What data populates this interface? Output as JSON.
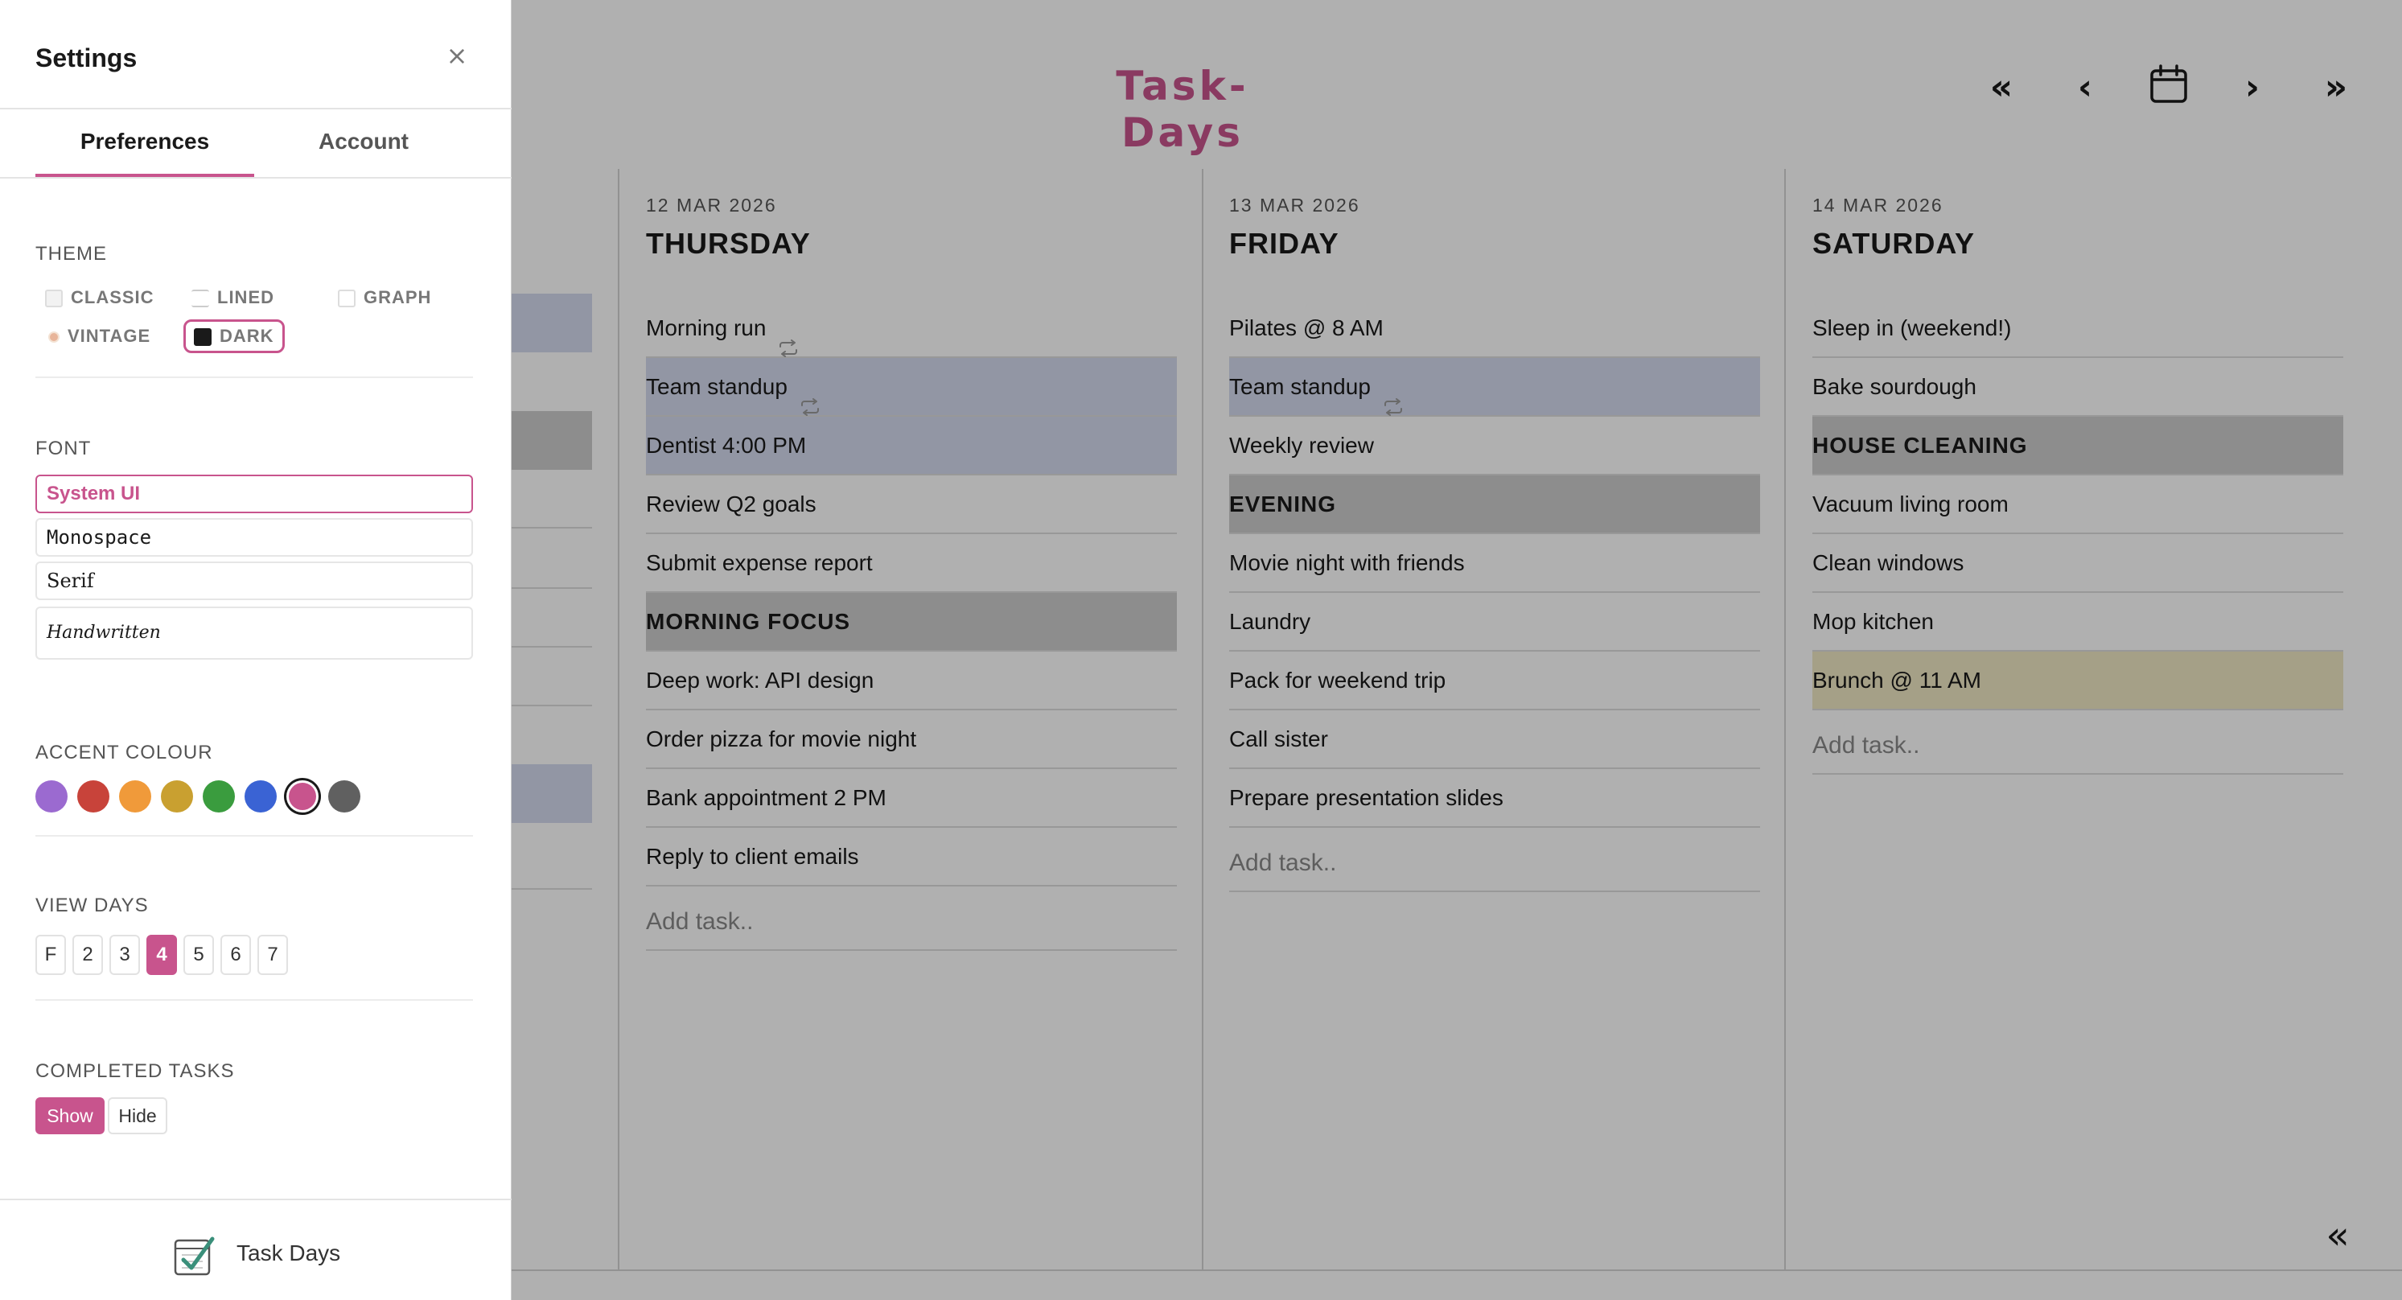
{
  "app": {
    "title": "Task-Days",
    "nav": {
      "first_label": "«",
      "prev_label": "‹",
      "next_label": "›",
      "last_label": "»",
      "collapse_label": "«"
    },
    "accent_color": "#c8548d"
  },
  "days": [
    {
      "date": "12 MAR 2026",
      "name": "THURSDAY",
      "tasks": [
        {
          "text": "Morning run",
          "repeat": true,
          "highlight": "none"
        },
        {
          "text": "Team standup",
          "repeat": true,
          "highlight": "blue"
        },
        {
          "text": "Dentist 4:00 PM",
          "repeat": false,
          "highlight": "blue"
        },
        {
          "text": "Review Q2 goals",
          "repeat": false,
          "highlight": "none"
        },
        {
          "text": "Submit expense report",
          "repeat": false,
          "highlight": "none"
        },
        {
          "text": "MORNING FOCUS",
          "repeat": false,
          "highlight": "heading"
        },
        {
          "text": "Deep work: API design",
          "repeat": false,
          "highlight": "none"
        },
        {
          "text": "Order pizza for movie night",
          "repeat": false,
          "highlight": "none"
        },
        {
          "text": "Bank appointment 2 PM",
          "repeat": false,
          "highlight": "none"
        },
        {
          "text": "Reply to client emails",
          "repeat": false,
          "highlight": "none"
        }
      ],
      "add_placeholder": "Add task.."
    },
    {
      "date": "13 MAR 2026",
      "name": "FRIDAY",
      "tasks": [
        {
          "text": "Pilates @ 8 AM",
          "repeat": false,
          "highlight": "none"
        },
        {
          "text": "Team standup",
          "repeat": true,
          "highlight": "blue"
        },
        {
          "text": "Weekly review",
          "repeat": false,
          "highlight": "none"
        },
        {
          "text": "EVENING",
          "repeat": false,
          "highlight": "heading"
        },
        {
          "text": "Movie night with friends",
          "repeat": false,
          "highlight": "none"
        },
        {
          "text": "Laundry",
          "repeat": false,
          "highlight": "none"
        },
        {
          "text": "Pack for weekend trip",
          "repeat": false,
          "highlight": "none"
        },
        {
          "text": "Call sister",
          "repeat": false,
          "highlight": "none"
        },
        {
          "text": "Prepare presentation slides",
          "repeat": false,
          "highlight": "none"
        }
      ],
      "add_placeholder": "Add task.."
    },
    {
      "date": "14 MAR 2026",
      "name": "SATURDAY",
      "tasks": [
        {
          "text": "Sleep in (weekend!)",
          "repeat": false,
          "highlight": "none"
        },
        {
          "text": "Bake sourdough",
          "repeat": false,
          "highlight": "none"
        },
        {
          "text": "HOUSE CLEANING",
          "repeat": false,
          "highlight": "heading"
        },
        {
          "text": "Vacuum living room",
          "repeat": false,
          "highlight": "none"
        },
        {
          "text": "Clean windows",
          "repeat": false,
          "highlight": "none"
        },
        {
          "text": "Mop kitchen",
          "repeat": false,
          "highlight": "none"
        },
        {
          "text": "Brunch @ 11 AM",
          "repeat": false,
          "highlight": "yellow"
        }
      ],
      "add_placeholder": "Add task.."
    }
  ],
  "settings": {
    "title": "Settings",
    "close_label": "×",
    "tabs": [
      "Preferences",
      "Account"
    ],
    "active_tab": "Preferences",
    "theme": {
      "label": "THEME",
      "options": [
        "CLASSIC",
        "LINED",
        "GRAPH",
        "VINTAGE",
        "DARK"
      ],
      "selected": "DARK"
    },
    "font": {
      "label": "FONT",
      "options": [
        "System UI",
        "Monospace",
        "Serif",
        "Handwritten"
      ],
      "selected": "System UI"
    },
    "accent": {
      "label": "ACCENT COLOUR",
      "colors": [
        "#9b6ad0",
        "#c8433a",
        "#f09a3a",
        "#c9a030",
        "#3a9c3e",
        "#3a63d4",
        "#c8548d",
        "#606060"
      ],
      "selected": "#c8548d"
    },
    "view_days": {
      "label": "VIEW DAYS",
      "options": [
        "F",
        "2",
        "3",
        "4",
        "5",
        "6",
        "7"
      ],
      "selected": "4"
    },
    "completed_tasks": {
      "label": "COMPLETED TASKS",
      "options": [
        "Show",
        "Hide"
      ],
      "selected": "Show"
    },
    "footer": {
      "app_name": "Task Days"
    }
  }
}
